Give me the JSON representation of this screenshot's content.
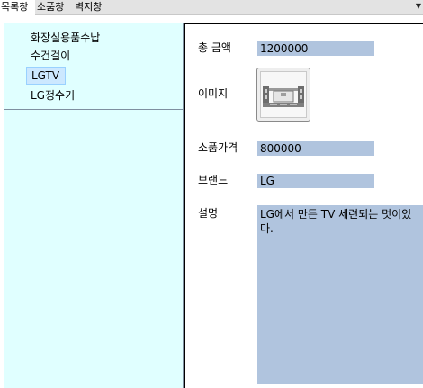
{
  "tabs": [
    {
      "label": "목록창",
      "active": true
    },
    {
      "label": "소품창",
      "active": false
    },
    {
      "label": "벽지창",
      "active": false
    }
  ],
  "menu_arrow_icon": "chevron-down-icon",
  "list": {
    "items": [
      {
        "label": "화장실용품수납",
        "selected": false
      },
      {
        "label": "수건걸이",
        "selected": false
      },
      {
        "label": "LGTV",
        "selected": true
      },
      {
        "label": "LG정수기",
        "selected": false
      }
    ]
  },
  "detail": {
    "total_label": "총 금액",
    "total_value": "1200000",
    "image_label": "이미지",
    "image_icon": "tv-image-icon",
    "price_label": "소품가격",
    "price_value": "800000",
    "brand_label": "브랜드",
    "brand_value": "LG",
    "desc_label": "설명",
    "desc_value": "LG에서 만든 TV 세련되는 멋이있다."
  },
  "colors": {
    "left_panel_bg": "#e0ffff",
    "field_bg": "#b0c4de",
    "selected_bg": "#cce8ff"
  }
}
